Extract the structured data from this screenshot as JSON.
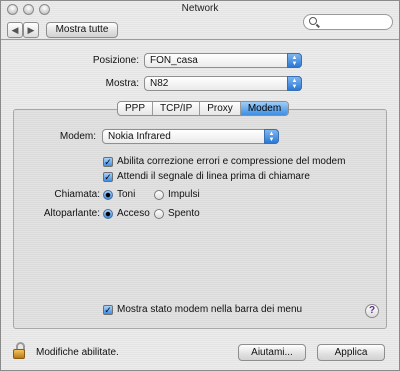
{
  "window": {
    "title": "Network"
  },
  "toolbar": {
    "show_all_label": "Mostra tutte",
    "search_placeholder": ""
  },
  "location": {
    "label": "Posizione:",
    "value": "FON_casa"
  },
  "show": {
    "label": "Mostra:",
    "value": "N82"
  },
  "tabs": [
    {
      "label": "PPP",
      "active": false
    },
    {
      "label": "TCP/IP",
      "active": false
    },
    {
      "label": "Proxy",
      "active": false
    },
    {
      "label": "Modem",
      "active": true
    }
  ],
  "modem": {
    "label": "Modem:",
    "value": "Nokia Infrared",
    "error_correction_label": "Abilita correzione errori e compressione del modem",
    "error_correction_checked": true,
    "wait_dialtone_label": "Attendi il segnale di linea prima di chiamare",
    "wait_dialtone_checked": true,
    "dialing_label": "Chiamata:",
    "dialing_options": [
      "Toni",
      "Impulsi"
    ],
    "dialing_selected": "Toni",
    "speaker_label": "Altoparlante:",
    "speaker_options": [
      "Acceso",
      "Spento"
    ],
    "speaker_selected": "Acceso",
    "menu_status_label": "Mostra stato modem nella barra dei menu",
    "menu_status_checked": true
  },
  "footer": {
    "lock_text": "Modifiche abilitate.",
    "help_label": "Aiutami...",
    "apply_label": "Applica"
  },
  "help_glyph": "?"
}
